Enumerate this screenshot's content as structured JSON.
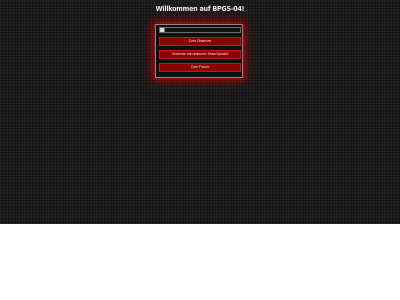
{
  "page": {
    "title": "Willkommen auf BPGS-04!"
  },
  "panel": {
    "buttons": [
      {
        "label": "Zum Observer"
      },
      {
        "label": "Verbinde mit unserem TeamSpeak3"
      },
      {
        "label": "Zum Forum"
      }
    ]
  },
  "colors": {
    "background": "#1c1c1c",
    "button": "#8b0000",
    "glow": "#d20000"
  }
}
